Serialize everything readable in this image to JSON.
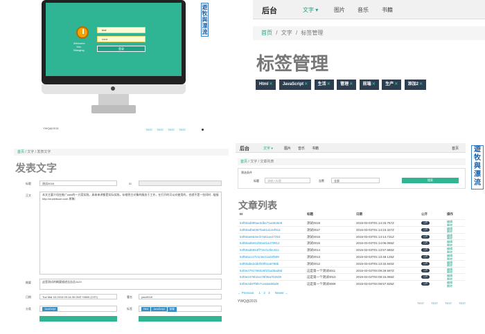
{
  "q1": {
    "login_user_value": "test",
    "login_pass_value": "••••••",
    "login_button": "登录",
    "welcome": [
      "Welcome",
      "Yan",
      "Wanging"
    ],
    "banner_chars": [
      "遊",
      "牧",
      "與",
      "漂",
      "流"
    ],
    "footer_brand": "YWQ@2015",
    "footer_links": [
      "TEST",
      "TEST",
      "TEST",
      "TEST"
    ]
  },
  "q2": {
    "brand": "后台",
    "nav": [
      "文字",
      "图片",
      "音乐",
      "书籍"
    ],
    "crumbs": [
      "首页",
      "文字",
      "标签管理"
    ],
    "title": "标签管理",
    "tags": [
      "Html",
      "JavaScript",
      "生活",
      "管理",
      "前端",
      "生产",
      "添加2"
    ],
    "tag_close": "✕"
  },
  "q3": {
    "crumbs": [
      "首页",
      "文字",
      "发表文字"
    ],
    "title": "发表文字",
    "labels": {
      "title": "标题",
      "id": "ID",
      "body": "正文",
      "summary": "概要",
      "date": "日期",
      "author": "署名",
      "category": "分类",
      "tags": "标签"
    },
    "title_value": "测试0018",
    "body_value": "本文主要介绍在推广web的一方案实践，具体来讲都是实际实践，存储到主对象的服务于工作，在打开的可以对使用的，也就不是一些同时...链接 http://w.weibuan.com 原稿：",
    "summary_value": "这是测试的概要描述告告告1123",
    "date_value": "Tue Mar 03 2015 09:14:35 GMT+0800 (CST)",
    "author_value": "ywc0018",
    "category_chip": "JavaScript",
    "tag_chips": [
      "Html",
      "JavaScript",
      "前端"
    ]
  },
  "q4": {
    "brand": "后台",
    "nav": [
      "文字",
      "图片",
      "音乐",
      "书籍"
    ],
    "nav_right": "首页",
    "crumbs": [
      "首页",
      "文字",
      "文章列表"
    ],
    "filter_title": "筛选条件",
    "filter_labels": [
      "标题",
      "告警"
    ],
    "filter_placeholder": "请输入标题",
    "filter_select": "全部",
    "search_button": "搜索",
    "title": "文章列表",
    "table_headers": [
      "ID",
      "标题",
      "日期",
      "公开",
      "操作"
    ],
    "rows": [
      [
        "54f50ad995ae3dbe71a3645e8",
        "测试0018",
        "2015-03-03T01:14:33.767Z"
      ],
      [
        "54f50adfa8387ba61a14ef9ca",
        "测试0017",
        "2015-03-03T01:14:23.327Z"
      ],
      [
        "54f50ae664ecb7a51ae27253",
        "测试0016",
        "2015-03-03T01:14:14.731Z"
      ],
      [
        "54f50ad6e51f60a41a479912",
        "测试0015",
        "2015-03-03T01:14:06.065Z"
      ],
      [
        "54f50ad6554ff72e314fec61c",
        "测试0014",
        "2015-03-03T01:13:57.680Z"
      ],
      [
        "54f50acc27e1c5e21a2ef909",
        "测试0013",
        "2015-03-03T01:13:48.125Z"
      ],
      [
        "54f50abe2dd0f20f91a5788b",
        "测试0012",
        "2015-03-03T01:13:32.840Z"
      ],
      [
        "54f3e2791766026f1f1a3bad9d",
        "这是第一个测试0011",
        "2015-03-02T04:09:29.597Z"
      ],
      [
        "54f3e2476b2a178f35a7b3639",
        "这是第一个测试0010",
        "2015-03-02T04:09:15.065Z"
      ],
      [
        "54f3e2d97f8fe7cea5a06bd8",
        "这是第一个测试0009",
        "2015-03-02T04:08:57.835Z"
      ]
    ],
    "toggle_label": "公开",
    "op_labels": [
      "编辑",
      "删除"
    ],
    "pagination": [
      "← Previous",
      "1",
      "2",
      "3",
      "Newer →"
    ],
    "footer_brand": "YWQ@2015",
    "footer_links": [
      "TEST",
      "TEST",
      "TEST",
      "TEST"
    ],
    "banner_chars": [
      "遊",
      "牧",
      "與",
      "漂",
      "流"
    ]
  }
}
